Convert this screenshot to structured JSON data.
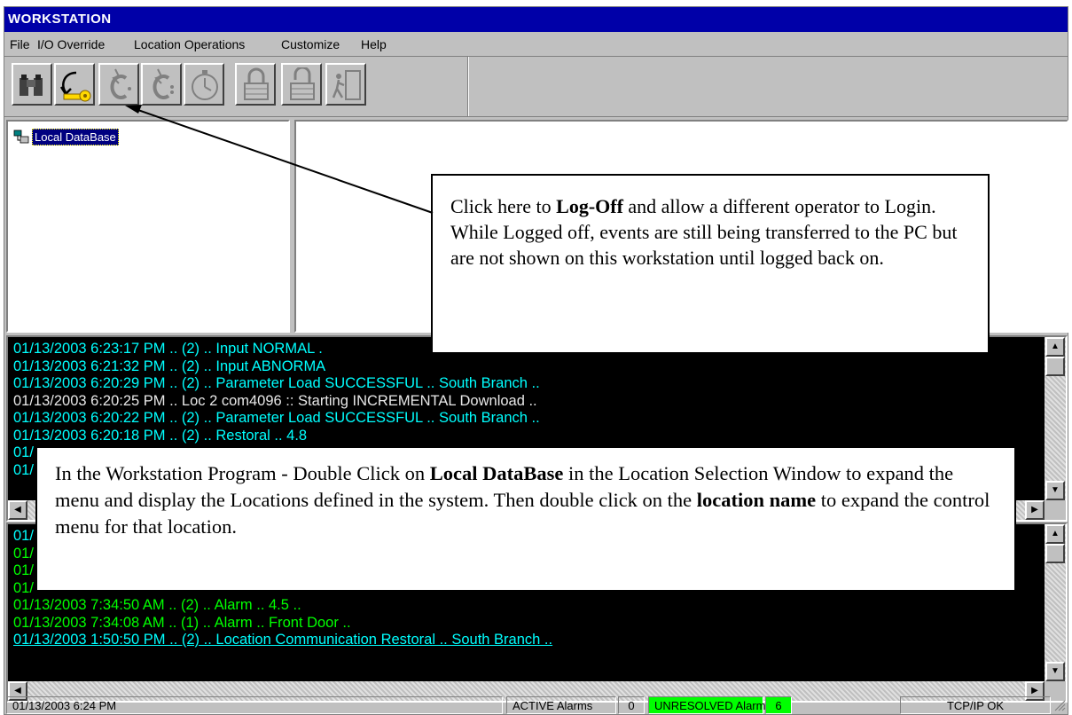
{
  "window": {
    "title": "WORKSTATION"
  },
  "menu": [
    "File",
    "I/O Override",
    "Location Operations",
    "Customize",
    "Help"
  ],
  "toolbar": {
    "buttons": [
      {
        "name": "binoculars-icon",
        "enabled": true
      },
      {
        "name": "key-logoff-icon",
        "enabled": true
      },
      {
        "name": "c-lightning-icon",
        "enabled": false
      },
      {
        "name": "c-lightning-alt-icon",
        "enabled": false
      },
      {
        "name": "stopwatch-icon",
        "enabled": false
      },
      {
        "name": "lock-icon",
        "enabled": false
      },
      {
        "name": "unlock-icon",
        "enabled": false
      },
      {
        "name": "exit-door-icon",
        "enabled": false
      }
    ]
  },
  "tree": {
    "root_label": "Local DataBase"
  },
  "log1": {
    "lines": [
      {
        "text": "01/13/2003 6:23:17 PM .. (2) .. Input NORMAL .",
        "color": "#00ffff"
      },
      {
        "text": "01/13/2003 6:21:32 PM .. (2) .. Input ABNORMA",
        "color": "#00ffff"
      },
      {
        "text": "01/13/2003 6:20:29 PM .. (2) .. Parameter Load SUCCESSFUL .. South Branch ..",
        "color": "#00ffff"
      },
      {
        "text": "01/13/2003 6:20:25 PM .. Loc 2  com4096 :: Starting INCREMENTAL Download ..",
        "color": "#e8e8e8"
      },
      {
        "text": "01/13/2003 6:20:22 PM .. (2) .. Parameter Load SUCCESSFUL .. South Branch ..",
        "color": "#00ffff"
      },
      {
        "text": "01/13/2003 6:20:18 PM .. (2) .. Restoral .. 4.8",
        "color": "#00ffff"
      },
      {
        "text": "01/",
        "color": "#00ffff"
      },
      {
        "text": "01/",
        "color": "#00ffff"
      }
    ]
  },
  "log2": {
    "lines": [
      {
        "text": "01/",
        "color": "#00ffff"
      },
      {
        "text": "01/",
        "color": "#00ff00"
      },
      {
        "text": "01/",
        "color": "#00ff00"
      },
      {
        "text": "01/",
        "color": "#00ff00"
      },
      {
        "text": "01/13/2003 7:34:50 AM .. (2) .. Alarm .. 4.5 ..",
        "color": "#00ff00"
      },
      {
        "text": "01/13/2003 7:34:08 AM .. (1) .. Alarm .. Front Door ..",
        "color": "#00ff00"
      },
      {
        "text": "01/13/2003 1:50:50 PM .. (2) .. Location Communication Restoral .. South Branch ..",
        "color": "#00ffff"
      }
    ]
  },
  "status": {
    "datetime": "01/13/2003 6:24 PM",
    "active_label": "ACTIVE Alarms",
    "active_count": "0",
    "unresolved_label": "UNRESOLVED Alarms",
    "unresolved_count": "6",
    "unresolved_color": "#00ff00",
    "connection": "TCP/IP OK"
  },
  "callout1": {
    "t1": "Click here to ",
    "b1": "Log-Off",
    "t2": " and allow a different operator to Login. While Logged off, events are still being transferred to the PC but are not shown on this workstation until logged back on."
  },
  "callout2": {
    "t1": "In the Workstation Program - Double Click on ",
    "b1": "Local DataBase",
    "t2": " in the Location Selection Window to expand the menu and display the Locations defined in the system. Then double click on the ",
    "b2": "location name",
    "t3": " to expand the control menu for that location."
  }
}
